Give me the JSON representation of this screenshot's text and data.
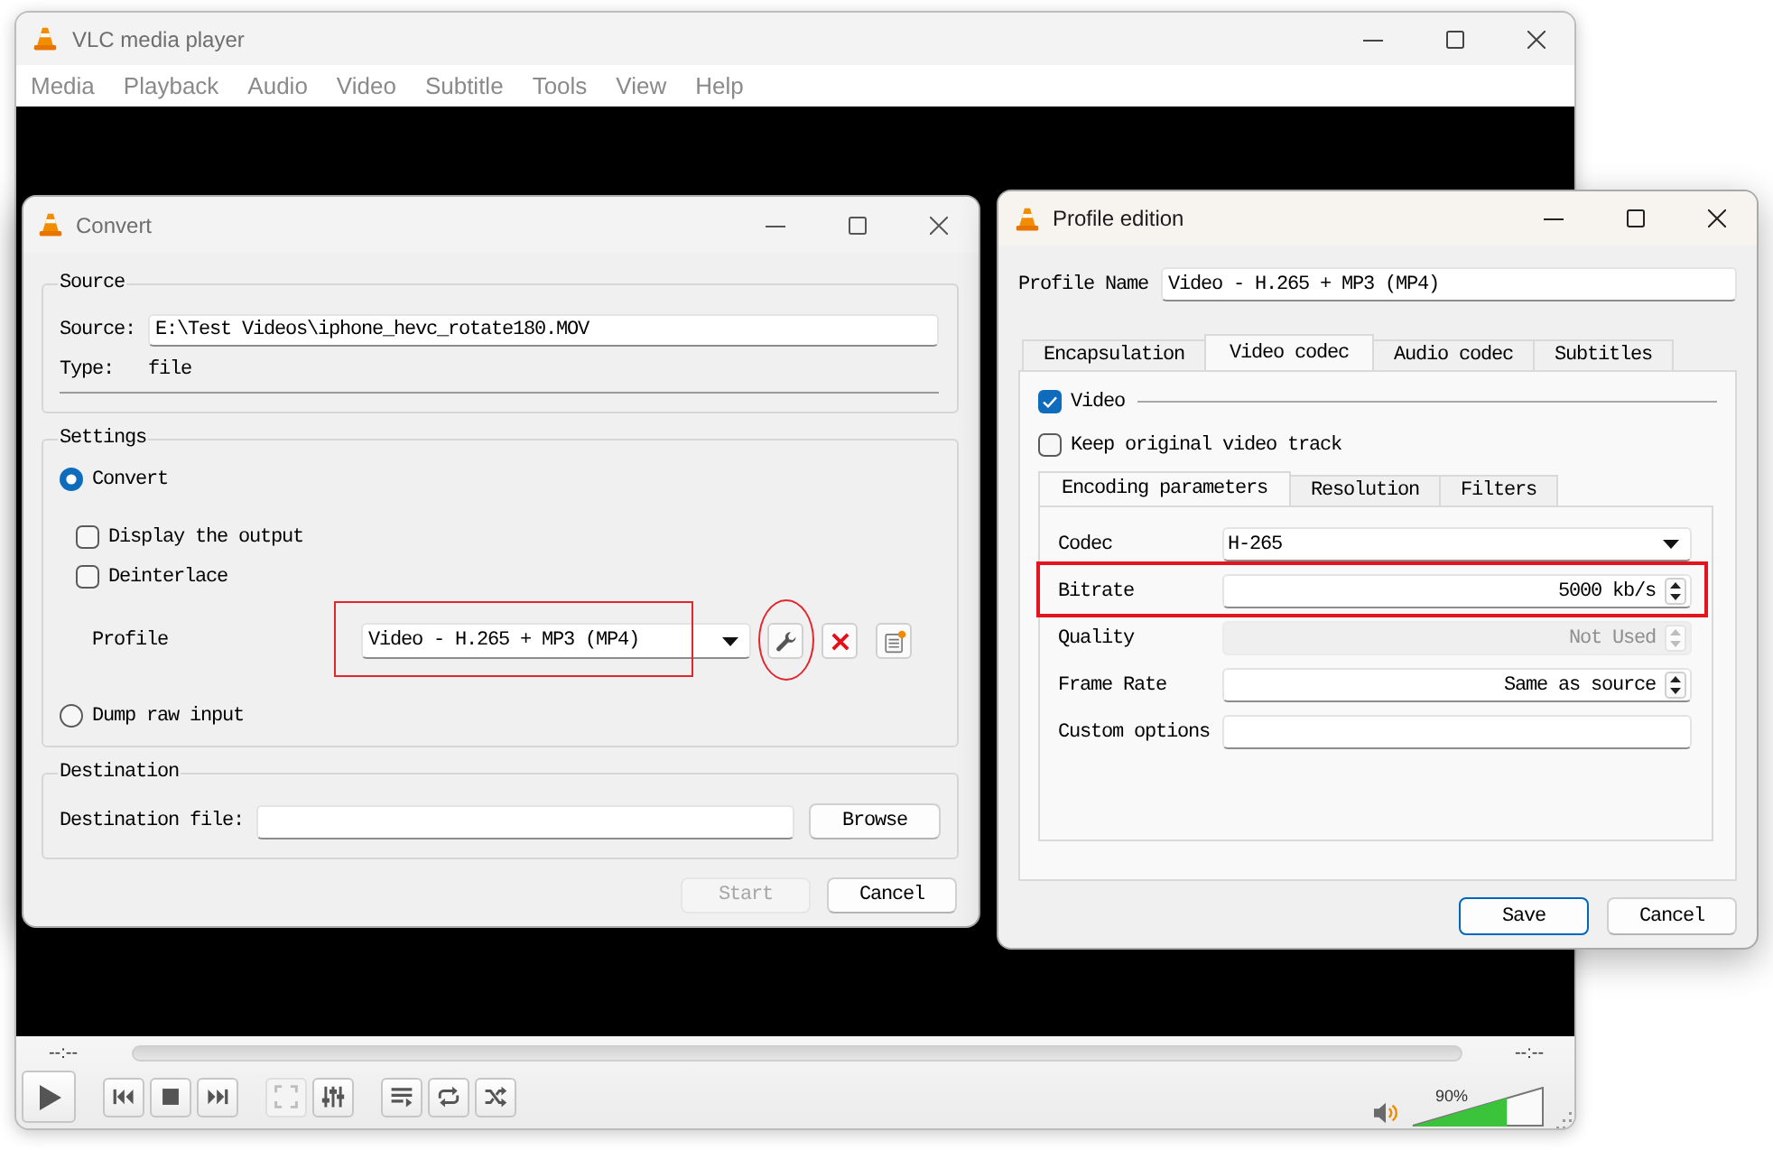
{
  "main_window": {
    "title": "VLC media player",
    "active": false,
    "menu": [
      "Media",
      "Playback",
      "Audio",
      "Video",
      "Subtitle",
      "Tools",
      "View",
      "Help"
    ],
    "elapsed": "--:--",
    "total": "--:--",
    "seek": {
      "disabled": true
    },
    "controls": [
      {
        "kind": "play",
        "disabled": false
      },
      {
        "kind": "previous",
        "disabled": false
      },
      {
        "kind": "stop",
        "disabled": false
      },
      {
        "kind": "next",
        "disabled": false
      },
      {
        "kind": "fullscreen",
        "disabled": true
      },
      {
        "kind": "extended",
        "disabled": false
      },
      {
        "kind": "playlist",
        "disabled": false
      },
      {
        "kind": "loop",
        "disabled": false
      },
      {
        "kind": "shuffle",
        "disabled": false
      }
    ],
    "volume": {
      "reading": "90%",
      "level": 0.72
    }
  },
  "convert": {
    "title": "Convert",
    "active": false,
    "source": {
      "heading": "Source",
      "source_label": "Source:",
      "source_value": "E:\\Test Videos\\iphone_hevc_rotate180.MOV",
      "type_label": "Type:",
      "type_value": "file"
    },
    "settings": {
      "heading": "Settings",
      "modes": [
        {
          "label": "Convert",
          "selected": true
        },
        {
          "label": "Dump raw input",
          "selected": false
        }
      ],
      "options": [
        {
          "label": "Display the output",
          "checked": false
        },
        {
          "label": "Deinterlace",
          "checked": false
        }
      ],
      "profile_label": "Profile",
      "profile_value": "Video - H.265 + MP3 (MP4)",
      "profile_marked": true,
      "edit_marked": true
    },
    "destination": {
      "heading": "Destination",
      "label": "Destination file:",
      "button": "Browse"
    },
    "buttons": [
      {
        "label": "Start",
        "disabled": true
      },
      {
        "label": "Cancel",
        "disabled": false
      }
    ]
  },
  "profile_edition": {
    "title": "Profile edition",
    "active": true,
    "name_label": "Profile Name",
    "name_value": "Video - H.265 + MP3 (MP4)",
    "tabs": [
      {
        "label": "Encapsulation",
        "selected": false
      },
      {
        "label": "Video codec",
        "selected": true
      },
      {
        "label": "Audio codec",
        "selected": false
      },
      {
        "label": "Subtitles",
        "selected": false
      }
    ],
    "video": {
      "label": "Video",
      "checked": true
    },
    "keep_original": {
      "label": "Keep original video track",
      "checked": false
    },
    "subtabs": [
      {
        "label": "Encoding parameters",
        "selected": true
      },
      {
        "label": "Resolution",
        "selected": false
      },
      {
        "label": "Filters",
        "selected": false
      }
    ],
    "fields": [
      {
        "kind": "combo",
        "label": "Codec",
        "value": "H-265",
        "disabled": false,
        "marked": false
      },
      {
        "kind": "spin",
        "label": "Bitrate",
        "value": "5000 kb/s",
        "disabled": false,
        "marked": true
      },
      {
        "kind": "spin",
        "label": "Quality",
        "value": "Not Used",
        "disabled": true,
        "marked": false
      },
      {
        "kind": "spin",
        "label": "Frame Rate",
        "value": "Same as source",
        "disabled": false,
        "marked": false
      },
      {
        "kind": "text",
        "label": "Custom options",
        "disabled": false,
        "marked": false
      }
    ],
    "buttons": [
      {
        "label": "Save",
        "default": true
      },
      {
        "label": "Cancel",
        "default": false
      }
    ]
  }
}
